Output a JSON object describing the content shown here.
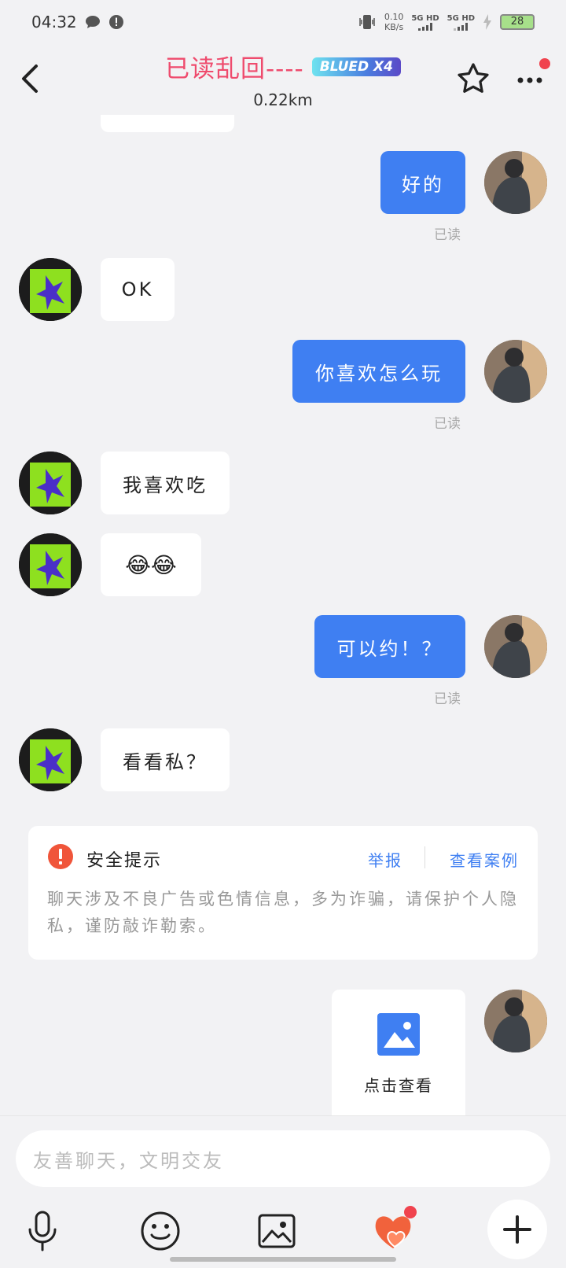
{
  "status_bar": {
    "time": "04:32",
    "net_speed_value": "0.10",
    "net_speed_unit": "KB/s",
    "sim1": "5G HD",
    "sim2": "5G HD",
    "battery": "28"
  },
  "header": {
    "title": "已读乱回----",
    "badge": "BLUED X4",
    "distance": "0.22km"
  },
  "messages": [
    {
      "from": "me",
      "text": "好的",
      "status": "已读"
    },
    {
      "from": "other",
      "text": "OK"
    },
    {
      "from": "me",
      "text": "你喜欢怎么玩",
      "status": "已读"
    },
    {
      "from": "other",
      "text": "我喜欢吃"
    },
    {
      "from": "other",
      "text": "😂😂"
    },
    {
      "from": "me",
      "text": "可以约！？",
      "status": "已读"
    },
    {
      "from": "other",
      "text": "看看私？"
    }
  ],
  "safety_notice": {
    "title": "安全提示",
    "report_label": "举报",
    "cases_label": "查看案例",
    "body": "聊天涉及不良广告或色情信息，多为诈骗，请保护个人隐私，谨防敲诈勒索。"
  },
  "image_message": {
    "label": "点击查看"
  },
  "input": {
    "placeholder": "友善聊天，文明交友"
  },
  "colors": {
    "accent": "#3f7ff2",
    "title": "#ef4b6d",
    "badge_dot": "#f0434e"
  },
  "toolbar_icons": [
    "microphone-icon",
    "emoji-icon",
    "image-icon",
    "heart-gift-icon",
    "plus-icon"
  ]
}
